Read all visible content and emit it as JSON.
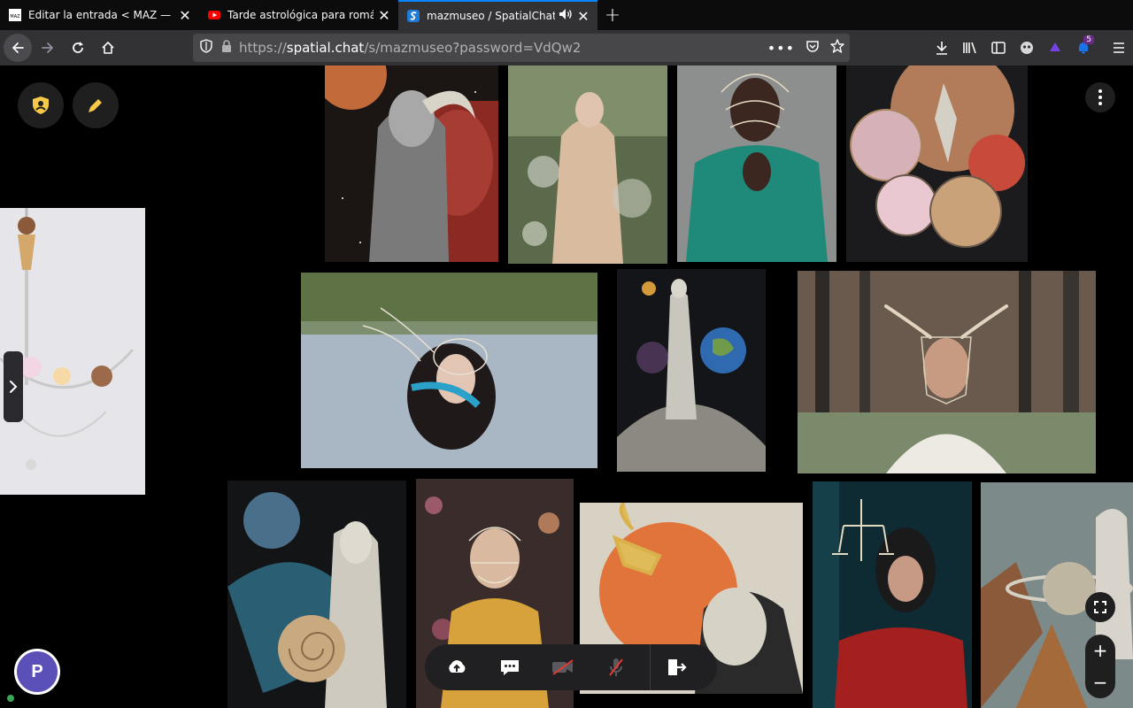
{
  "browser": {
    "tabs": [
      {
        "title": "Editar la entrada < MAZ — WordPress",
        "favicon": "maz-favicon"
      },
      {
        "title": "Tarde astrológica para románticos",
        "favicon": "youtube-favicon"
      },
      {
        "title": "mazmuseo / SpatialChat",
        "favicon": "spatialchat-favicon",
        "active": true,
        "audio": true
      }
    ],
    "url_prefix": "https://",
    "url_host": "spatial.chat",
    "url_path": "/s/mazmuseo?password=VdQw2",
    "extension_badge": "5"
  },
  "app": {
    "avatar_initial": "P",
    "artworks": [
      "collage-woman-ram-horns-space",
      "woman-in-flowering-branches",
      "man-wire-mask-teal-shirt",
      "collage-figures-astrolabe-discs",
      "woman-water-wire-fish-tail",
      "collage-woman-on-planet",
      "man-wire-bull-horns-forest",
      "chandelier-sweets-sculpture",
      "collage-woman-earth-nautilus",
      "woman-wire-mask-yellow-dress",
      "collage-scorpion-woman-orange-sun",
      "woman-wire-scales-red-dress",
      "collage-woman-saturn-landscape"
    ]
  },
  "colors": {
    "accent": "#0a84ff",
    "avatar": "#5b4fb8",
    "pencil": "#f7c948",
    "shield": "#f7c948"
  }
}
